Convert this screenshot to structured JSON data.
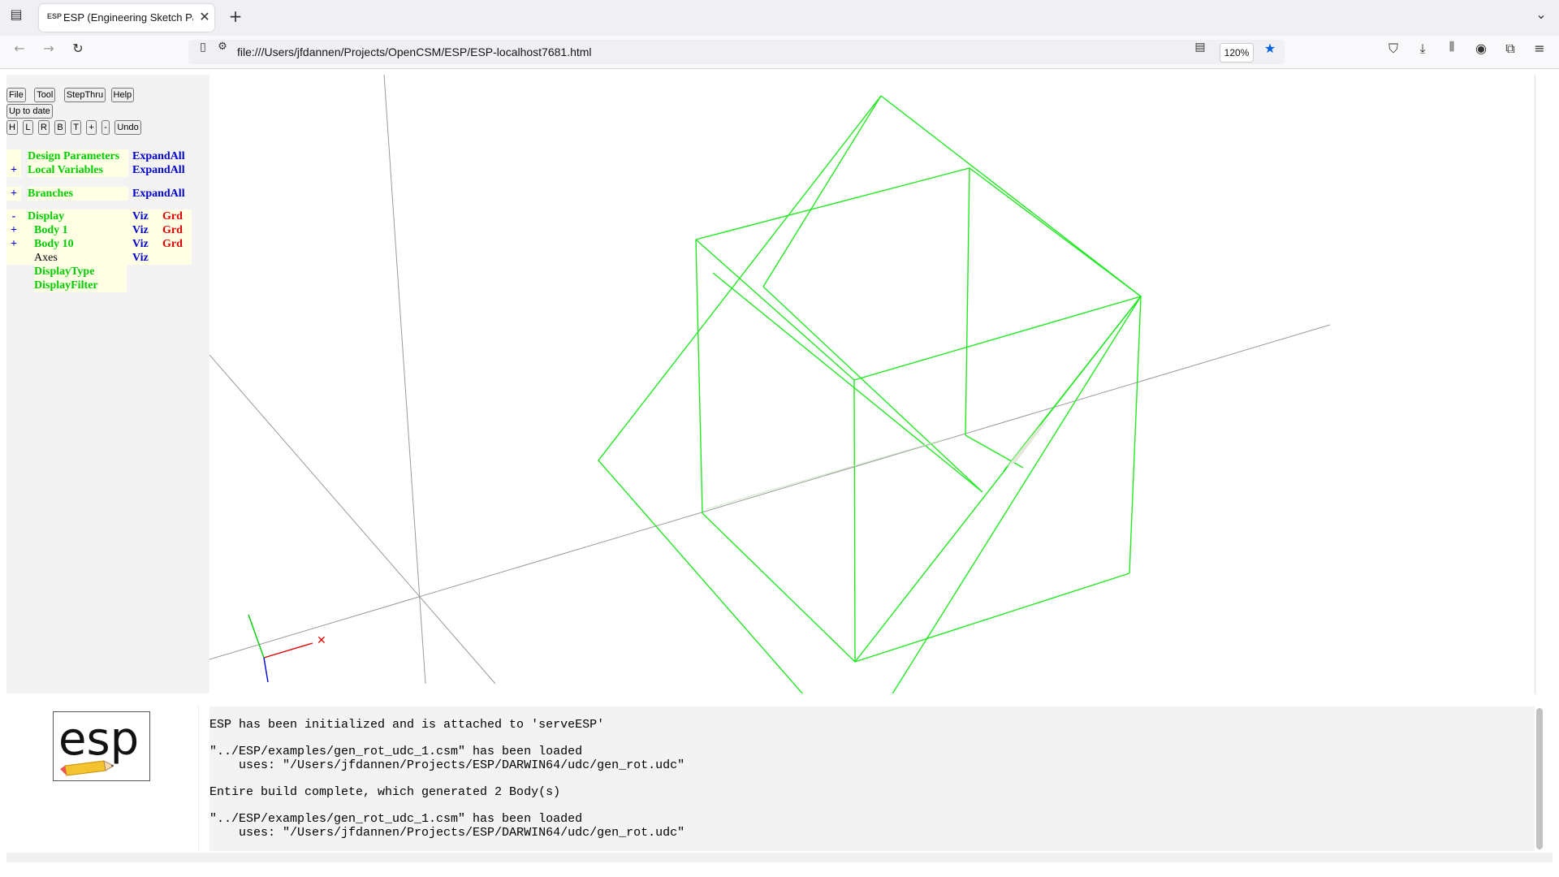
{
  "browser": {
    "tab_title": "ESP (Engineering Sketch Pad, V",
    "tab_favicon_text": "ESP",
    "url": "file:///Users/jfdannen/Projects/OpenCSM/ESP/ESP-localhost7681.html",
    "zoom": "120%"
  },
  "toolbar": {
    "row1": [
      "File",
      "Tool",
      "StepThru",
      "Help"
    ],
    "row2": [
      "Up to date"
    ],
    "row3": [
      "H",
      "L",
      "R",
      "B",
      "T",
      "+",
      "-",
      "Undo"
    ]
  },
  "tree": {
    "design_parameters": {
      "label": "Design Parameters",
      "action": "ExpandAll"
    },
    "local_variables": {
      "toggle": "+",
      "label": "Local Variables",
      "action": "ExpandAll"
    },
    "branches": {
      "toggle": "+",
      "label": "Branches",
      "action": "ExpandAll"
    },
    "display": {
      "toggle": "-",
      "label": "Display",
      "viz": "Viz",
      "grd": "Grd"
    },
    "body1": {
      "toggle": "+",
      "label": "Body 1",
      "viz": "Viz",
      "grd": "Grd"
    },
    "body10": {
      "toggle": "+",
      "label": "Body 10",
      "viz": "Viz",
      "grd": "Grd"
    },
    "axes": {
      "label": "Axes",
      "viz": "Viz"
    },
    "display_type": {
      "label": "DisplayType"
    },
    "display_filter": {
      "label": "DisplayFilter"
    }
  },
  "logo_text": "esp",
  "messages": [
    "ESP has been initialized and is attached to 'serveESP'",
    "\"../ESP/examples/gen_rot_udc_1.csm\" has been loaded",
    "    uses: \"/Users/jfdannen/Projects/ESP/DARWIN64/udc/gen_rot.udc\"",
    "Entire build complete, which generated 2 Body(s)",
    "\"../ESP/examples/gen_rot_udc_1.csm\" has been loaded",
    "    uses: \"/Users/jfdannen/Projects/ESP/DARWIN64/udc/gen_rot.udc\""
  ],
  "colors": {
    "wireframe": "#22e822",
    "axis_x": "#e00000",
    "axis_y": "#00cc00",
    "axis_z": "#0000dd",
    "tree_green": "#00cc00",
    "tree_blue": "#0000cc",
    "tree_red": "#dd0000"
  }
}
